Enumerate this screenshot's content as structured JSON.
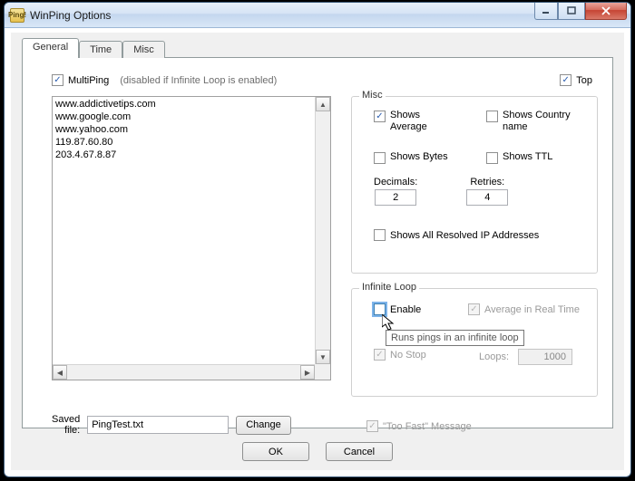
{
  "title_icon_text": "Ping!",
  "window_title": "WinPing Options",
  "tabs": {
    "general": "General",
    "time": "Time",
    "misc": "Misc"
  },
  "general": {
    "multiping_label": "MultiPing",
    "multiping_disabled_note": "(disabled if Infinite Loop is enabled)",
    "top_label": "Top",
    "hosts_text": "www.addictivetips.com\nwww.google.com\nwww.yahoo.com\n119.87.60.80\n203.4.67.8.87",
    "saved_file_label": "Saved\nfile:",
    "saved_file_value": "PingTest.txt",
    "change_label": "Change"
  },
  "misc": {
    "legend": "Misc",
    "shows_average": "Shows\nAverage",
    "shows_country": "Shows Country\nname",
    "shows_bytes": "Shows Bytes",
    "shows_ttl": "Shows TTL",
    "decimals_label": "Decimals:",
    "decimals_value": "2",
    "retries_label": "Retries:",
    "retries_value": "4",
    "shows_all_ip": "Shows All Resolved IP Addresses"
  },
  "loop": {
    "legend": "Infinite Loop",
    "enable": "Enable",
    "avg_realtime": "Average in Real Time",
    "tooltip": "Runs pings in an infinite loop",
    "no_stop": "No Stop",
    "loops_label": "Loops:",
    "loops_value": "1000"
  },
  "toofast_label": "\"Too Fast\" Message",
  "buttons": {
    "ok": "OK",
    "cancel": "Cancel"
  }
}
